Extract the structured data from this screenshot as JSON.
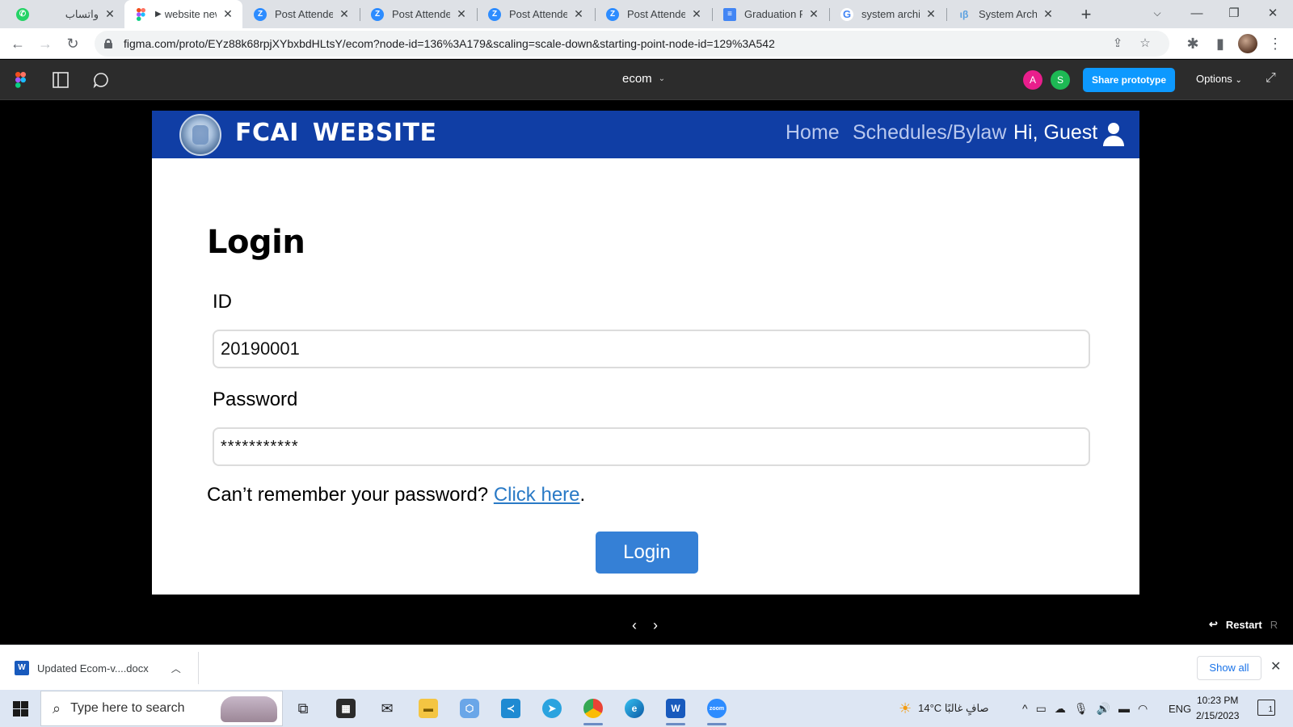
{
  "browser": {
    "tabs": [
      {
        "title": "واتساب",
        "favicon": "whatsapp-icon",
        "active": false
      },
      {
        "title": "website new",
        "favicon": "figma-icon",
        "active": true,
        "playing": true
      },
      {
        "title": "Post Attendee",
        "favicon": "zoom-icon",
        "active": false
      },
      {
        "title": "Post Attendee",
        "favicon": "zoom-icon",
        "active": false
      },
      {
        "title": "Post Attendee",
        "favicon": "zoom-icon",
        "active": false
      },
      {
        "title": "Post Attendee",
        "favicon": "zoom-icon",
        "active": false
      },
      {
        "title": "Graduation Pr",
        "favicon": "google-docs-icon",
        "active": false
      },
      {
        "title": "system archite",
        "favicon": "google-icon",
        "active": false
      },
      {
        "title": "System Archit",
        "favicon": "beta-icon",
        "active": false
      }
    ],
    "url": "figma.com/proto/EYz88k68rpjXYbxbdHLtsY/ecom?node-id=136%3A179&scaling=scale-down&starting-point-node-id=129%3A542",
    "colors": {
      "tabstrip": "#dee1e6",
      "omnibox": "#f1f3f4"
    }
  },
  "figma": {
    "file_name": "ecom",
    "collaborators": [
      {
        "initial": "A",
        "color": "#e91e8c"
      },
      {
        "initial": "S",
        "color": "#1db954"
      }
    ],
    "share_label": "Share prototype",
    "options_label": "Options",
    "restart_label": "Restart",
    "restart_key": "R",
    "accent": "#0d99ff"
  },
  "site": {
    "title": "FCAI  WEBSITE",
    "nav": {
      "home": "Home",
      "schedules": "Schedules/Bylaw"
    },
    "greeting": "Hi, Guest",
    "header_color": "#103ea5"
  },
  "login": {
    "heading": "Login",
    "id_label": "ID",
    "id_value": "20190001",
    "password_label": "Password",
    "password_value": "***********",
    "forgot_text": "Can’t remember your password? ",
    "forgot_link": "Click here",
    "forgot_suffix": ".",
    "button_label": "Login",
    "button_color": "#3580d6"
  },
  "downloads": {
    "file_name": "Updated Ecom-v....docx",
    "show_all": "Show all"
  },
  "taskbar": {
    "search_placeholder": "Type here to search",
    "weather": "14°C  صافٍ غالبًا",
    "language": "ENG",
    "time": "10:23 PM",
    "date": "2/15/2023",
    "notification_count": "1"
  }
}
